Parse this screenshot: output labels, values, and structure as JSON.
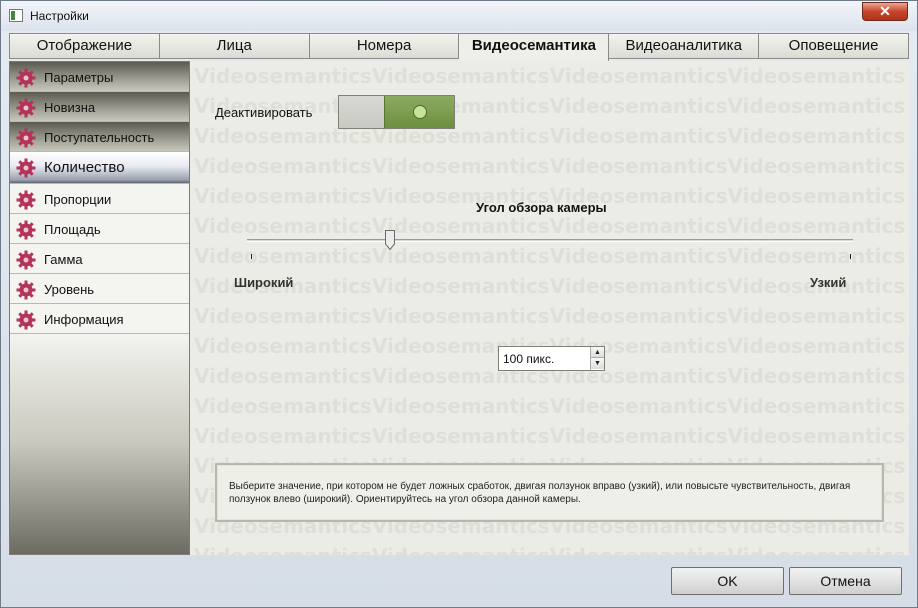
{
  "window": {
    "title": "Настройки",
    "close_glyph": "✕"
  },
  "tabs": [
    {
      "label": "Отображение"
    },
    {
      "label": "Лица"
    },
    {
      "label": "Номера"
    },
    {
      "label": "Видеосемантика",
      "active": true
    },
    {
      "label": "Видеоаналитика"
    },
    {
      "label": "Оповещение"
    }
  ],
  "sidebar": {
    "items": [
      {
        "label": "Параметры",
        "icon": "gear-icon"
      },
      {
        "label": "Новизна",
        "icon": "gear-icon"
      },
      {
        "label": "Поступательность",
        "icon": "gear-icon"
      },
      {
        "label": "Количество",
        "icon": "gear-icon",
        "selected": true
      },
      {
        "label": "Пропорции",
        "icon": "gear-icon"
      },
      {
        "label": "Площадь",
        "icon": "gear-icon"
      },
      {
        "label": "Гамма",
        "icon": "gear-icon"
      },
      {
        "label": "Уровень",
        "icon": "gear-icon"
      },
      {
        "label": "Информация",
        "icon": "gear-icon"
      }
    ]
  },
  "content": {
    "watermark": "Videosemantics",
    "deactivate_label": "Деактивировать",
    "toggle_on": true,
    "slider": {
      "title": "Угол обзора камеры",
      "min_label": "Широкий",
      "max_label": "Узкий",
      "position_fraction": 0.235
    },
    "spinner_value": "100 пикс.",
    "info_text": "Выберите значение, при котором не будет ложных сработок, двигая ползунок вправо (узкий), или повысьте чувствительность, двигая ползунок влево (широкий). Ориентируйтесь на угол обзора данной камеры."
  },
  "footer": {
    "ok_label": "OK",
    "cancel_label": "Отмена"
  },
  "colors": {
    "gear": "#b4335a",
    "toggle_on": "#7a9a4a",
    "accent_close": "#c8452c"
  }
}
